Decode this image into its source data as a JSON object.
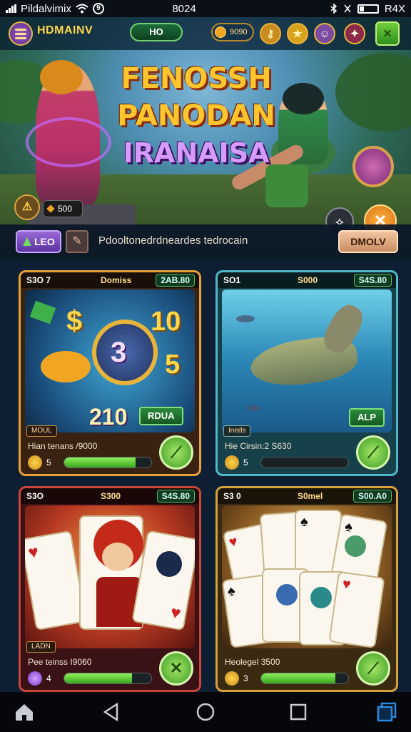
{
  "status_bar": {
    "carrier": "Pildalvimix",
    "time": "8024",
    "battery_text": "R4X"
  },
  "header": {
    "brand": "HDMAINV",
    "pill_label": "HO",
    "coins": "9090"
  },
  "hero": {
    "title_line1": "FENOSSH",
    "title_line2": "PANODAN",
    "title_line3": "IRANAISA",
    "score": "500"
  },
  "promo": {
    "left_button": "LEO",
    "text": "Pdooltonedrdneardes tedrocain",
    "right_button": "DMOLV"
  },
  "cards": [
    {
      "head_left": "S3O 7",
      "head_mid": "Domiss",
      "head_right": "2AB.80",
      "art_labels": [
        "$",
        "10",
        "3",
        "5",
        "210"
      ],
      "chip": "RDUA",
      "tag": "MOUL",
      "foot": "Hian tenans /9000",
      "count": "5",
      "progress": 0.82,
      "accent": "#e8a23a"
    },
    {
      "head_left": "SO1",
      "head_mid": "S000",
      "head_right": "S4S.80",
      "chip": "ALP",
      "tag": "Ineds",
      "foot": "Hie Cirsin:2 S630",
      "count": "5",
      "progress": 0.0,
      "accent": "#4fb8c9"
    },
    {
      "head_left": "S3O",
      "head_mid": "S300",
      "head_right": "S4S.80",
      "tag": "LADN",
      "foot": "Pee teinss I9060",
      "count": "4",
      "progress": 0.78,
      "accent": "#c8463a"
    },
    {
      "head_left": "S3 0",
      "head_mid": "S0mel",
      "head_right": "S00.A0",
      "foot": "Heolegel 3500",
      "count": "3",
      "progress": 0.85,
      "accent": "#d8a23a"
    }
  ]
}
